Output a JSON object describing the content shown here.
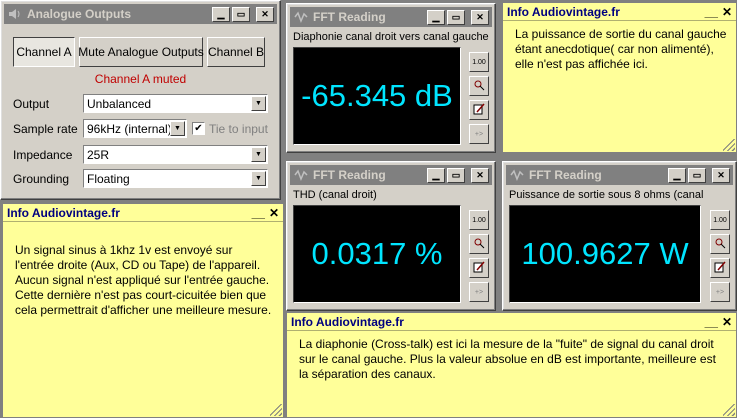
{
  "analogue": {
    "title": "Analogue Outputs",
    "tabs": [
      "Channel A",
      "Mute Analogue Outputs",
      "Channel B"
    ],
    "status": "Channel A muted",
    "fields": [
      {
        "label": "Output",
        "value": "Unbalanced"
      },
      {
        "label": "Sample rate",
        "value": "96kHz (internal)"
      },
      {
        "label": "Impedance",
        "value": "25R"
      },
      {
        "label": "Grounding",
        "value": "Floating"
      }
    ],
    "tie_label": "Tie to input",
    "tie_checked": true
  },
  "fft": [
    {
      "title": "FFT Reading",
      "label": "Diaphonie canal droit vers canal gauche",
      "value": "-65.345 dB"
    },
    {
      "title": "FFT Reading",
      "label": "THD (canal droit)",
      "value": "0.0317 %"
    },
    {
      "title": "FFT Reading",
      "label": "Puissance de sortie sous 8 ohms  (canal droit)",
      "value": "100.9627 W"
    }
  ],
  "fft_side_buttons": [
    "1.00",
    "",
    "",
    "+>"
  ],
  "info": [
    {
      "title": "Info Audiovintage.fr",
      "text": "La puissance de sortie du canal gauche étant anecdotique( car non alimenté), elle n'est pas affichée ici."
    },
    {
      "title": "Info Audiovintage.fr",
      "text": "Un signal sinus à 1khz 1v est envoyé sur l'entrée droite (Aux, CD ou Tape) de l'appareil.\nAucun signal n'est appliqué sur l'entrée gauche. Cette dernière n'est pas court-cicuitée bien que cela permettrait d'afficher une meilleure mesure."
    },
    {
      "title": "Info Audiovintage.fr",
      "text": "La diaphonie (Cross-talk) est ici la mesure de la \"fuite\" de signal du canal droit sur le canal gauche. Plus la valeur absolue en dB est importante, meilleure est la séparation des canaux."
    }
  ],
  "colors": {
    "readout": "#00e5ff",
    "muted_text": "#c00000",
    "info_bg": "#ffff99",
    "info_title": "#000080"
  }
}
